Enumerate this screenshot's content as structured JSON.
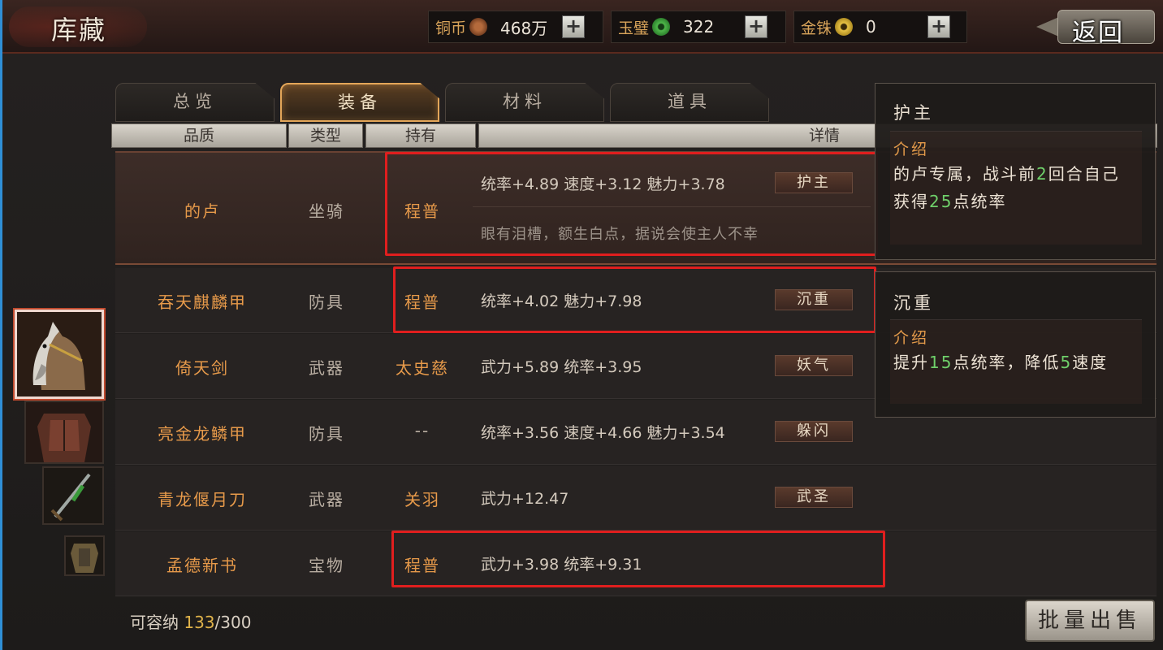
{
  "header": {
    "title": "库藏",
    "back_label": "返回",
    "currencies": [
      {
        "label": "铜币",
        "value": "468万",
        "icon": "copper-coin-icon"
      },
      {
        "label": "玉璧",
        "value": "322",
        "icon": "jade-disc-icon"
      },
      {
        "label": "金铢",
        "value": "0",
        "icon": "gold-coin-icon"
      }
    ],
    "plus_label": "+"
  },
  "tabs": [
    {
      "label": "总览",
      "active": false
    },
    {
      "label": "装备",
      "active": true
    },
    {
      "label": "材料",
      "active": false
    },
    {
      "label": "道具",
      "active": false
    }
  ],
  "columns": [
    "品质",
    "类型",
    "持有",
    "详情"
  ],
  "rows": [
    {
      "name": "的卢",
      "type": "坐骑",
      "owner": "程普",
      "stats": "统率+4.89  速度+3.12  魅力+3.78",
      "skill": "护主",
      "desc": "眼有泪槽，额生白点，据说会使主人不幸"
    },
    {
      "name": "吞天麒麟甲",
      "type": "防具",
      "owner": "程普",
      "stats": "统率+4.02  魅力+7.98",
      "skill": "沉重"
    },
    {
      "name": "倚天剑",
      "type": "武器",
      "owner": "太史慈",
      "stats": "武力+5.89  统率+3.95",
      "skill": "妖气"
    },
    {
      "name": "亮金龙鳞甲",
      "type": "防具",
      "owner": "--",
      "stats": "统率+3.56  速度+4.66  魅力+3.54",
      "skill": "躲闪"
    },
    {
      "name": "青龙偃月刀",
      "type": "武器",
      "owner": "关羽",
      "stats": "武力+12.47",
      "skill": "武圣"
    },
    {
      "name": "孟德新书",
      "type": "宝物",
      "owner": "程普",
      "stats": "武力+3.98  统率+9.31",
      "skill": ""
    }
  ],
  "tooltips": [
    {
      "title": "护主",
      "subtitle": "介绍",
      "text_parts": [
        "的卢专属，战斗前",
        "2",
        "回合自己获得",
        "25",
        "点统率"
      ]
    },
    {
      "title": "沉重",
      "subtitle": "介绍",
      "text_parts": [
        "提升",
        "15",
        "点统率，降低",
        "5",
        "速度"
      ]
    }
  ],
  "footer": {
    "capacity_label": "可容纳",
    "capacity_current": "133",
    "capacity_max": "/300",
    "sell_label": "批量出售"
  },
  "colors": {
    "accent": "#e79a4a",
    "highlight_box": "#e01e1e",
    "positive_number": "#6fd06a"
  }
}
